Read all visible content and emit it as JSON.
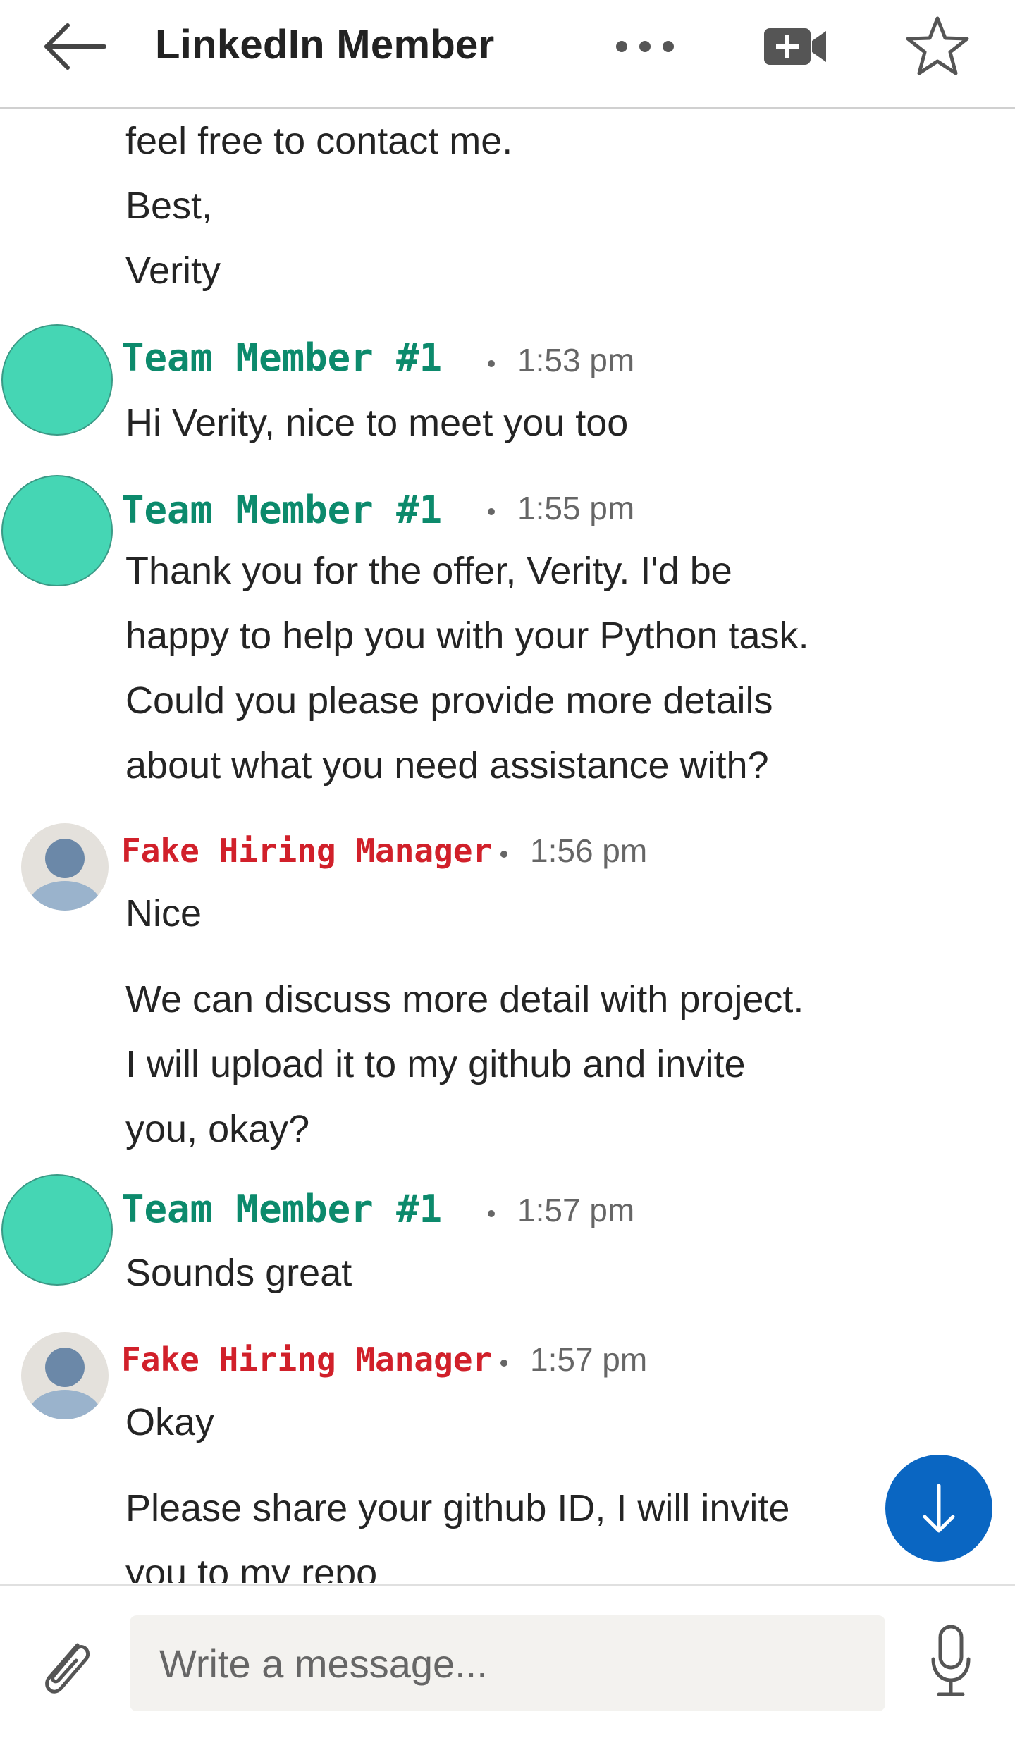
{
  "header": {
    "title": "LinkedIn Member",
    "back_icon": "arrow-left-icon",
    "more_icon": "more-horizontal-icon",
    "video_icon": "video-call-icon",
    "star_icon": "star-outline-icon"
  },
  "messages": {
    "top_lines": [
      "feel free to contact me.",
      "Best,",
      "Verity"
    ],
    "groups": [
      {
        "sender": "Team Member #1",
        "time": "1:53 pm",
        "lines": [
          "Hi Verity, nice to meet you too"
        ]
      },
      {
        "sender": "Team Member #1",
        "time": "1:55 pm",
        "lines": [
          "Thank you for the offer, Verity. I'd be",
          "happy to help you with your Python task.",
          "Could you please provide more details",
          "about what you need assistance with?"
        ]
      },
      {
        "sender": "Fake Hiring Manager",
        "time": "1:56 pm",
        "lines": [
          "Nice",
          "We can discuss more detail with project.",
          "I will upload it to my github and invite",
          "you, okay?"
        ]
      },
      {
        "sender": "Team Member #1",
        "time": "1:57 pm",
        "lines": [
          "Sounds great"
        ]
      },
      {
        "sender": "Fake Hiring Manager",
        "time": "1:57 pm",
        "lines": [
          "Okay",
          "Please share your github ID, I will invite",
          "you to my repo"
        ]
      }
    ]
  },
  "scroll_down_icon": "arrow-down-icon",
  "composer": {
    "placeholder": "Write a message...",
    "attach_icon": "paperclip-icon",
    "mic_icon": "microphone-icon"
  },
  "colors": {
    "team_member_name": "#0c8a6c",
    "fake_manager_name": "#d1202a",
    "team_avatar": "#45d6b4",
    "fab_blue": "#0a66c2",
    "input_bg": "#f3f2ef"
  }
}
